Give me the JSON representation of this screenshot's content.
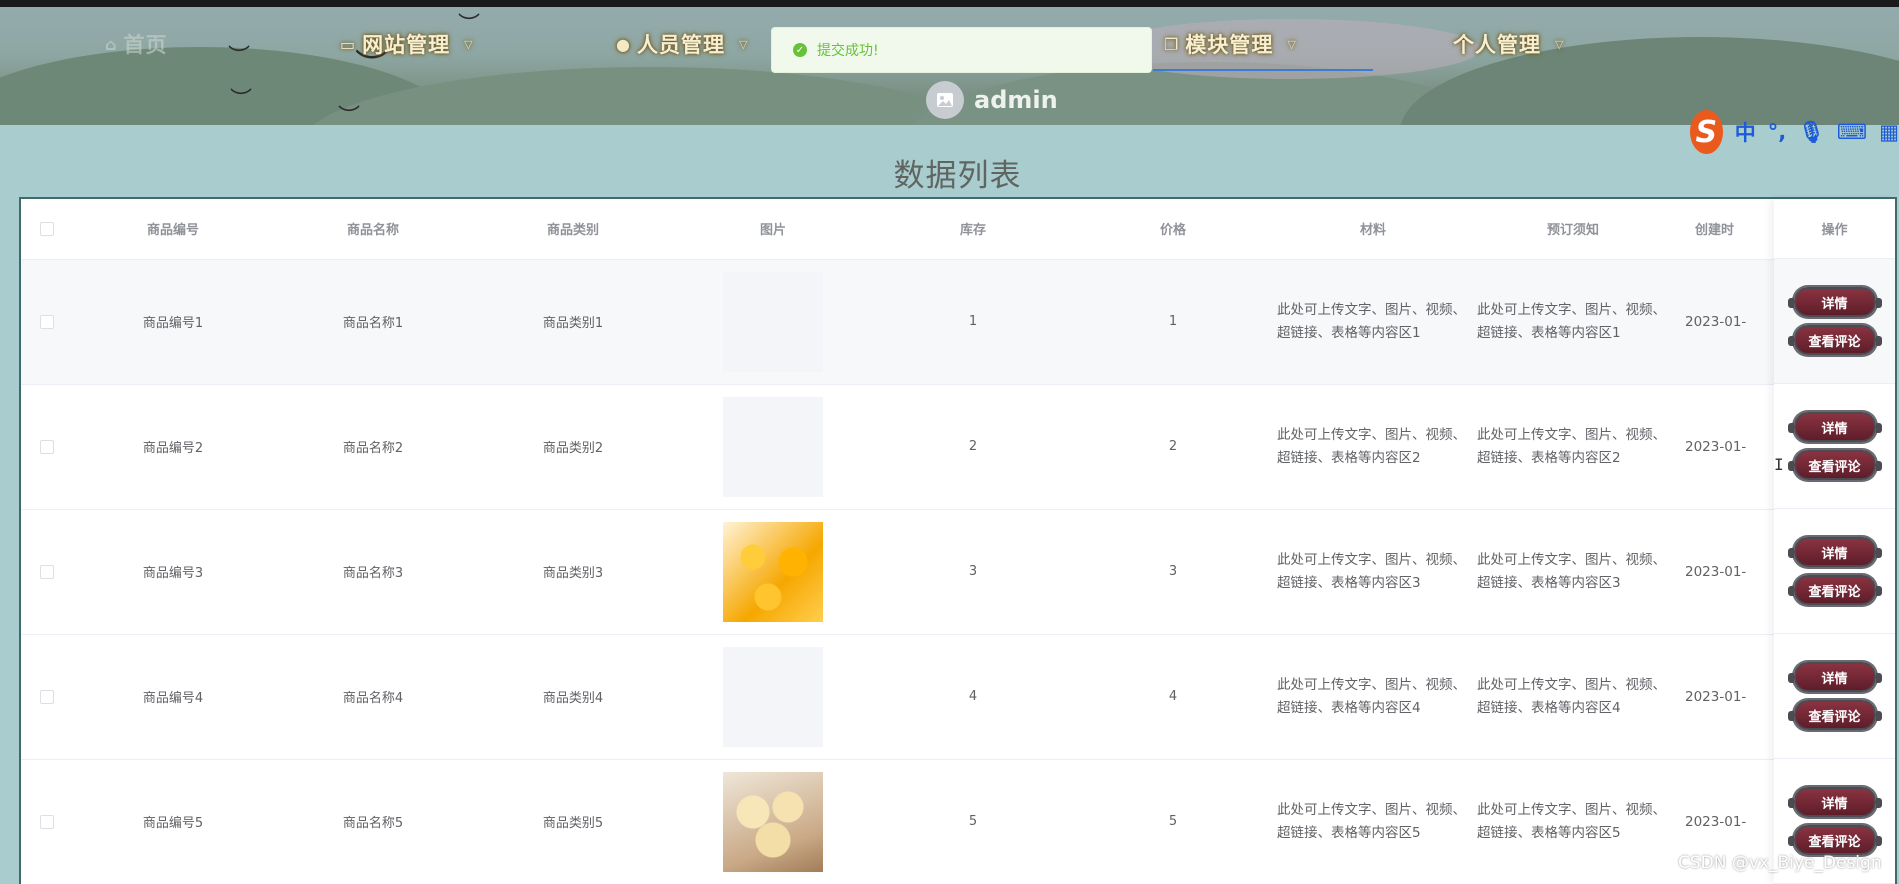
{
  "nav": {
    "items": [
      {
        "label": "首页",
        "icon": "home-icon"
      },
      {
        "label": "网站管理",
        "icon": "monitor-icon"
      },
      {
        "label": "人员管理",
        "icon": "user-icon"
      },
      {
        "label": "模块管理",
        "icon": "copy-icon"
      },
      {
        "label": "个人管理",
        "icon": "none"
      }
    ],
    "active": "模块管理",
    "username": "admin"
  },
  "toast": {
    "message": "提交成功!",
    "type": "success",
    "color": "#67c23a"
  },
  "ime": {
    "chars": [
      "中",
      "°,"
    ]
  },
  "page": {
    "title": "数据列表"
  },
  "table": {
    "headers": [
      "商品编号",
      "商品名称",
      "商品类别",
      "图片",
      "库存",
      "价格",
      "材料",
      "预订须知",
      "创建时",
      "操作"
    ],
    "rows": [
      {
        "code": "商品编号1",
        "name": "商品名称1",
        "category": "商品类别1",
        "image": "placeholder",
        "stock": "1",
        "price": "1",
        "material": "此处可上传文字、图片、视频、超链接、表格等内容区1",
        "notice": "此处可上传文字、图片、视频、超链接、表格等内容区1",
        "date": "2023-01-"
      },
      {
        "code": "商品编号2",
        "name": "商品名称2",
        "category": "商品类别2",
        "image": "placeholder",
        "stock": "2",
        "price": "2",
        "material": "此处可上传文字、图片、视频、超链接、表格等内容区2",
        "notice": "此处可上传文字、图片、视频、超链接、表格等内容区2",
        "date": "2023-01-"
      },
      {
        "code": "商品编号3",
        "name": "商品名称3",
        "category": "商品类别3",
        "image": "orange-cake",
        "stock": "3",
        "price": "3",
        "material": "此处可上传文字、图片、视频、超链接、表格等内容区3",
        "notice": "此处可上传文字、图片、视频、超链接、表格等内容区3",
        "date": "2023-01-"
      },
      {
        "code": "商品编号4",
        "name": "商品名称4",
        "category": "商品类别4",
        "image": "placeholder",
        "stock": "4",
        "price": "4",
        "material": "此处可上传文字、图片、视频、超链接、表格等内容区4",
        "notice": "此处可上传文字、图片、视频、超链接、表格等内容区4",
        "date": "2023-01-"
      },
      {
        "code": "商品编号5",
        "name": "商品名称5",
        "category": "商品类别5",
        "image": "buns",
        "stock": "5",
        "price": "5",
        "material": "此处可上传文字、图片、视频、超链接、表格等内容区5",
        "notice": "此处可上传文字、图片、视频、超链接、表格等内容区5",
        "date": "2023-01-"
      }
    ],
    "actions": {
      "detail": "详情",
      "comments": "查看评论"
    }
  },
  "watermark": "CSDN @vx_Biye_Design"
}
